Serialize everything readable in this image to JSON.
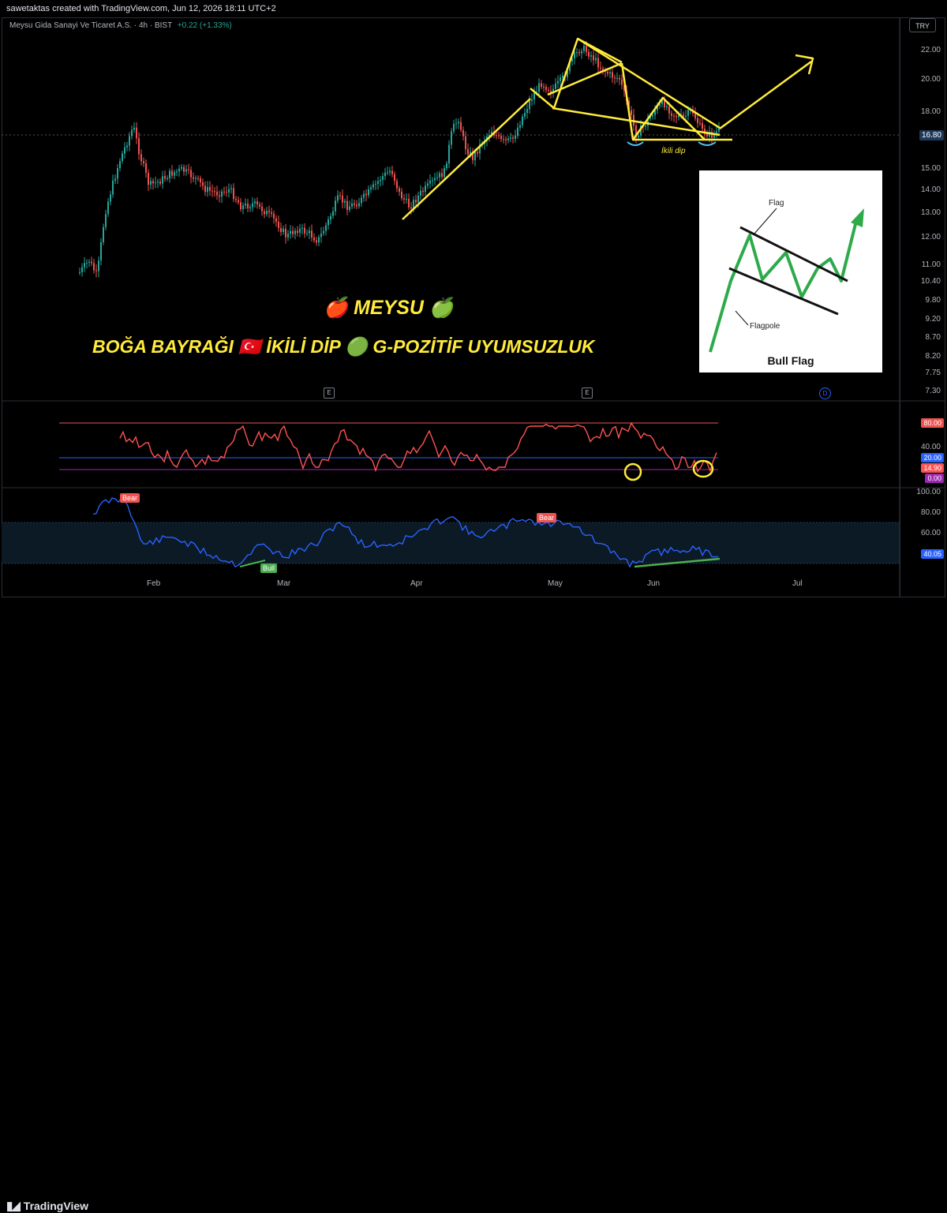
{
  "header": {
    "creator": "sawetaktas created with TradingView.com, Jun 12, 2026 18:11 UTC+2",
    "symbol": "Meysu Gida Sanayi Ve Ticaret A.S. · 4h · BIST",
    "change": "+0.22 (+1.33%)",
    "currency": "TRY"
  },
  "price_axis": {
    "labels": [
      "22.00",
      "20.00",
      "18.00",
      "16.80",
      "15.00",
      "14.00",
      "13.00",
      "12.00",
      "11.00",
      "10.40",
      "9.80",
      "9.20",
      "8.70",
      "8.20",
      "7.75",
      "7.30"
    ],
    "current_price": "16.80"
  },
  "oscillator_axis": {
    "labels": {
      "top": "80.00",
      "mid": "20.00",
      "value": "14.90",
      "bottom": "0.00",
      "label40": "40.00"
    }
  },
  "rsi_axis": {
    "labels": [
      "100.00",
      "80.00",
      "60.00",
      "40.05"
    ]
  },
  "time_axis": {
    "labels": [
      "Feb",
      "Mar",
      "Apr",
      "May",
      "Jun",
      "Jul"
    ]
  },
  "annotations": {
    "title_line1": "🍎 MEYSU 🍏",
    "title_line2": "BOĞA BAYRAĞI 🇹🇷 İKİLİ DİP 🟢 G-POZİTİF UYUMSUZLUK",
    "double_bottom": "İkili dip",
    "bear1": "Bear",
    "bear2": "Bear",
    "bull": "Bull",
    "event_mark": "E",
    "dividend_mark": "D"
  },
  "inset": {
    "title": "Bull Flag",
    "flag_label": "Flag",
    "flagpole_label": "Flagpole"
  },
  "footer": {
    "brand": "TradingView"
  },
  "colors": {
    "up": "#26a69a",
    "down": "#ef5350",
    "pattern": "#ffeb3b",
    "stoch": "#ff5252",
    "rsi": "#2962ff",
    "divergence": "#4caf50"
  }
}
